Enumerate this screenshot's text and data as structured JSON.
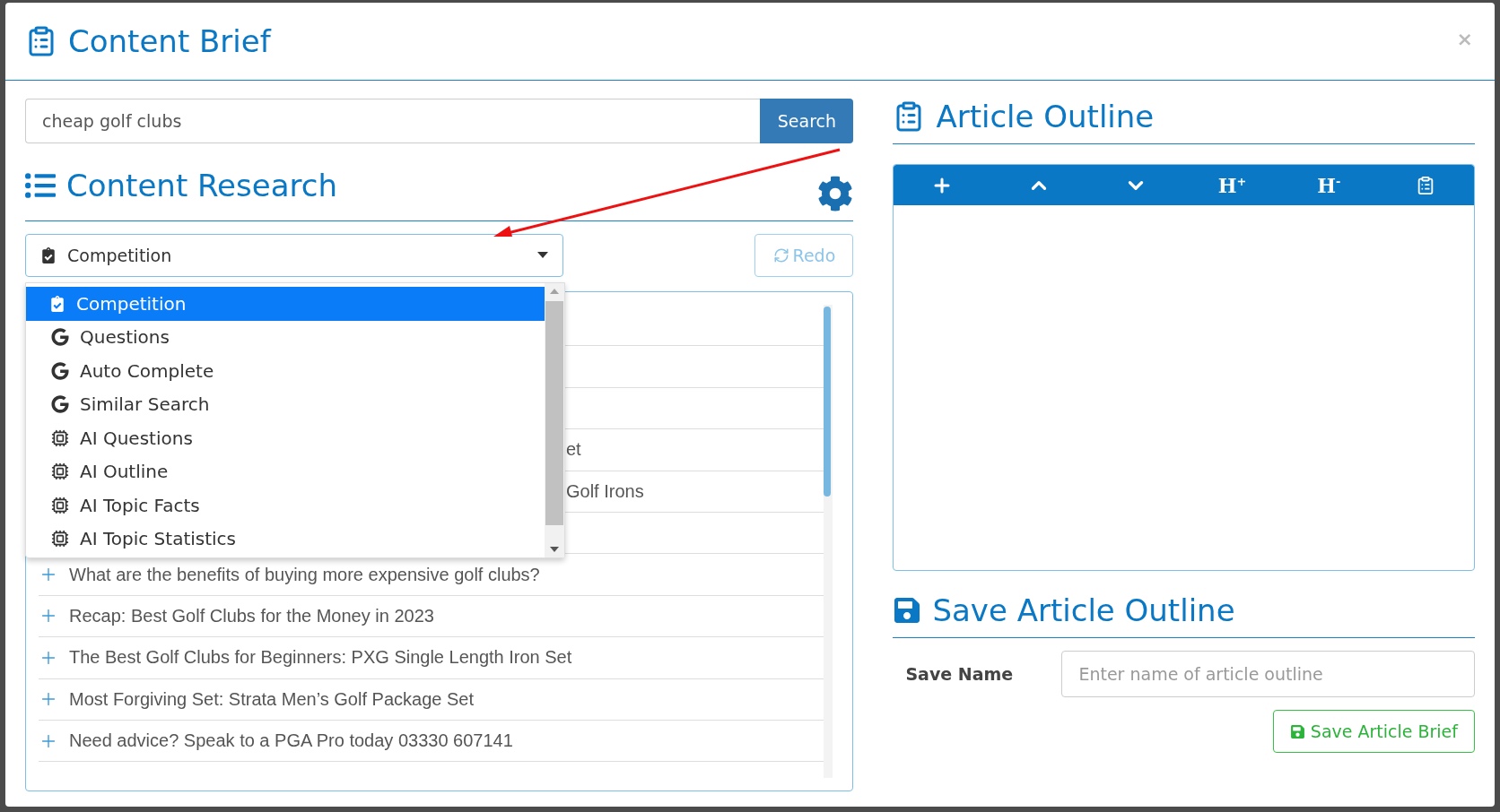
{
  "window": {
    "title": "Content Brief",
    "close": "×"
  },
  "search": {
    "value": "cheap golf clubs",
    "button": "Search"
  },
  "research": {
    "title": "Content Research",
    "select": {
      "value": "Competition"
    },
    "redo": "Redo",
    "menu": [
      {
        "label": "Competition",
        "kind": "clipboard",
        "selected": true
      },
      {
        "label": "Questions",
        "kind": "google",
        "selected": false
      },
      {
        "label": "Auto Complete",
        "kind": "google",
        "selected": false
      },
      {
        "label": "Similar Search",
        "kind": "google",
        "selected": false
      },
      {
        "label": "AI Questions",
        "kind": "ai",
        "selected": false
      },
      {
        "label": "AI Outline",
        "kind": "ai",
        "selected": false
      },
      {
        "label": "AI Topic Facts",
        "kind": "ai",
        "selected": false
      },
      {
        "label": "AI Topic Statistics",
        "kind": "ai",
        "selected": false
      }
    ],
    "results": [
      {
        "covered": true,
        "text": "et"
      },
      {
        "covered": true,
        "text": "Golf Irons"
      },
      {
        "covered": false,
        "text": "What are the benefits of buying more expensive golf clubs?"
      },
      {
        "covered": false,
        "text": "Recap: Best Golf Clubs for the Money in 2023"
      },
      {
        "covered": false,
        "text": "The Best Golf Clubs for Beginners: PXG Single Length Iron Set"
      },
      {
        "covered": false,
        "text": "Most Forgiving Set: Strata Men’s Golf Package Set"
      },
      {
        "covered": false,
        "text": "Need advice? Speak to a PGA Pro today 03330 607141"
      }
    ]
  },
  "outline": {
    "title": "Article Outline",
    "toolbar": [
      {
        "kind": "add"
      },
      {
        "kind": "up"
      },
      {
        "kind": "down"
      },
      {
        "kind": "heading",
        "label": "H$^{+}$"
      },
      {
        "kind": "heading",
        "label": "H$^{-}$"
      },
      {
        "kind": "clipboard"
      }
    ]
  },
  "save": {
    "title": "Save Article Outline",
    "label": "Save Name",
    "placeholder": "Enter name of article outline",
    "button": "Save Article Brief"
  }
}
